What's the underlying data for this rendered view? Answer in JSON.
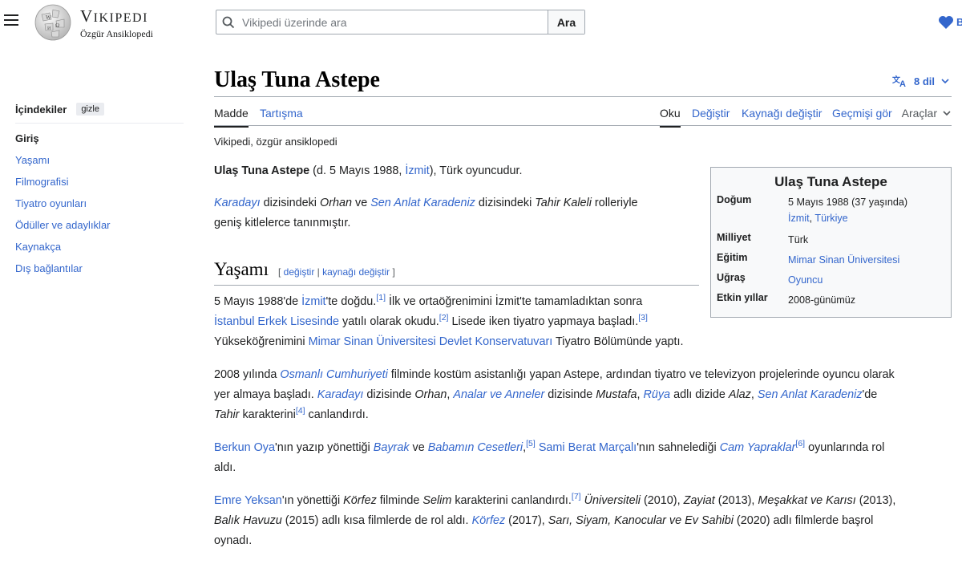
{
  "header": {
    "menu_icon": "hamburger-icon",
    "wordmark_title": "Vikipedi",
    "wordmark_tagline": "Özgür Ansiklopedi",
    "search_placeholder": "Vikipedi üzerinde ara",
    "search_button": "Ara",
    "donate_icon": "heart-icon",
    "donate_label": "B"
  },
  "toc": {
    "title": "İçindekiler",
    "hide_label": "gizle",
    "items": [
      {
        "label": "Giriş",
        "active": true
      },
      {
        "label": "Yaşamı",
        "active": false
      },
      {
        "label": "Filmografisi",
        "active": false
      },
      {
        "label": "Tiyatro oyunları",
        "active": false
      },
      {
        "label": "Ödüller ve adaylıklar",
        "active": false
      },
      {
        "label": "Kaynakça",
        "active": false
      },
      {
        "label": "Dış bağlantılar",
        "active": false
      }
    ]
  },
  "article": {
    "title": "Ulaş Tuna Astepe",
    "languages": "8 dil",
    "tabs_left": [
      "Madde",
      "Tartışma"
    ],
    "tabs_right": [
      "Oku",
      "Değiştir",
      "Kaynağı değiştir",
      "Geçmişi gör"
    ],
    "tools": "Araçlar",
    "tagline": "Vikipedi, özgür ansiklopedi",
    "section_heading": "Yaşamı",
    "section_edit": "değiştir",
    "section_edit_source": "kaynağı değiştir",
    "colors": {
      "link": "#3366cc",
      "text": "#202122",
      "border": "#a2a9b1"
    }
  },
  "infobox": {
    "title": "Ulaş Tuna Astepe",
    "rows": [
      {
        "key": "Doğum",
        "value": "5 Mayıs 1988 (37 yaşında)",
        "value2_a": "İzmit",
        "value2_b": "Türkiye"
      },
      {
        "key": "Milliyet",
        "value": "Türk"
      },
      {
        "key": "Eğitim",
        "value": "Mimar Sinan Üniversitesi"
      },
      {
        "key": "Uğraş",
        "value": "Oyuncu"
      },
      {
        "key": "Etkin yıllar",
        "value": "2008-günümüz"
      }
    ]
  },
  "text": {
    "p1_bold": "Ulaş Tuna Astepe",
    "p1_a": " (d. 5 Mayıs 1988, ",
    "p1_link": "İzmit",
    "p1_b": "), Türk oyuncudur.",
    "p2_l1": "Karadayı",
    "p2_a": " dizisindeki ",
    "p2_i1": "Orhan",
    "p2_b": " ve ",
    "p2_l2": "Sen Anlat Karadeniz",
    "p2_c": " dizisindeki ",
    "p2_i2": "Tahir Kaleli",
    "p2_d": " rolleriyle",
    "p2_line2": "geniş kitlelerce tanınmıştır.",
    "s1_a": "5 Mayıs 1988'de ",
    "s1_l1": "İzmit",
    "s1_b": "'te doğdu.",
    "s1_r1": "[1]",
    "s1_c": " İlk ve ortaöğrenimini İzmit'te tamamladıktan sonra",
    "s1_l2": "İstanbul Erkek Lisesinde",
    "s1_d": " yatılı olarak okudu.",
    "s1_r2": "[2]",
    "s1_e": " Lisede iken tiyatro yapmaya başladı.",
    "s1_r3": "[3]",
    "s1_f": "Yükseköğrenimini ",
    "s1_l3": "Mimar Sinan Üniversitesi Devlet Konservatuvarı",
    "s1_g": " Tiyatro Bölümünde yaptı.",
    "s2_a": "2008 yılında ",
    "s2_l1": "Osmanlı Cumhuriyeti",
    "s2_b": " filminde kostüm asistanlığı yapan Astepe, ardından tiyatro ve televizyon projelerinde oyuncu olarak",
    "s2_c": "yer almaya başladı. ",
    "s2_l2": "Karadayı",
    "s2_d": " dizisinde ",
    "s2_i1": "Orhan",
    "s2_e": ", ",
    "s2_l3": "Analar ve Anneler",
    "s2_f": " dizisinde ",
    "s2_i2": "Mustafa",
    "s2_g": ", ",
    "s2_l4": "Rüya",
    "s2_h": " adlı dizide ",
    "s2_i3": "Alaz",
    "s2_j": ", ",
    "s2_l5": "Sen Anlat Karadeniz",
    "s2_k": "'de",
    "s2_i4": "Tahir",
    "s2_m": " karakterini",
    "s2_r1": "[4]",
    "s2_n": " canlandırdı.",
    "s3_l1": "Berkun Oya",
    "s3_a": "'nın yazıp yönettiği ",
    "s3_l2": "Bayrak",
    "s3_b": " ve ",
    "s3_l3": "Babamın Cesetleri",
    "s3_c": ",",
    "s3_r1": "[5]",
    "s3_d": " ",
    "s3_l4": "Sami Berat Marçalı",
    "s3_e": "'nın sahnelediği ",
    "s3_l5": "Cam Yapraklar",
    "s3_r2": "[6]",
    "s3_f": " oyunlarında rol",
    "s3_g": "aldı.",
    "s4_l1": "Emre Yeksan",
    "s4_a": "'ın yönettiği ",
    "s4_i1": "Körfez",
    "s4_b": " filminde ",
    "s4_i2": "Selim",
    "s4_c": " karakterini canlandırdı.",
    "s4_r1": "[7]",
    "s4_d": " ",
    "s4_i3": "Üniversiteli",
    "s4_e": " (2010), ",
    "s4_i4": "Zayiat",
    "s4_f": " (2013), ",
    "s4_i5": "Meşakkat ve Karısı",
    "s4_g": " (2013),",
    "s4_i6": "Balık Havuzu",
    "s4_h": " (2015) adlı kısa filmlerde de rol aldı. ",
    "s4_l2": "Körfez",
    "s4_j": " (2017), ",
    "s4_i7": "Sarı, Siyam, Kanocular ve Ev Sahibi",
    "s4_k": " (2020) adlı filmlerde başrol",
    "s4_m": "oynadı."
  }
}
